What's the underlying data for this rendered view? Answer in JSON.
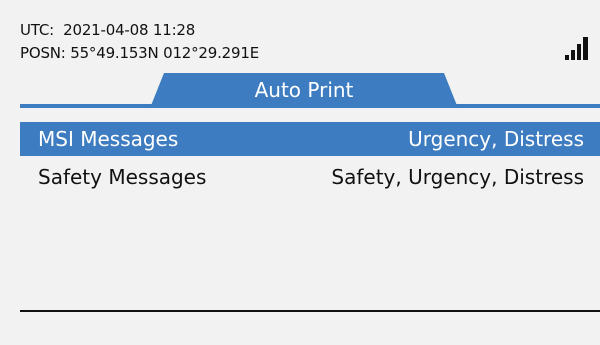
{
  "status": {
    "utc_label": "UTC:",
    "utc_value": "2021-04-08 11:28",
    "posn_label": "POSN:",
    "posn_value": "55°49.153N 012°29.291E",
    "signal_icon": "signal-strength-icon"
  },
  "tab": {
    "label": "Auto Print"
  },
  "menu": {
    "items": [
      {
        "label": "MSI Messages",
        "value": "Urgency, Distress",
        "selected": true
      },
      {
        "label": "Safety Messages",
        "value": "Safety, Urgency, Distress",
        "selected": false
      }
    ]
  },
  "colors": {
    "accent": "#3d7cc0",
    "background": "#f2f2f2",
    "text": "#111111",
    "selected_text": "#ffffff"
  }
}
